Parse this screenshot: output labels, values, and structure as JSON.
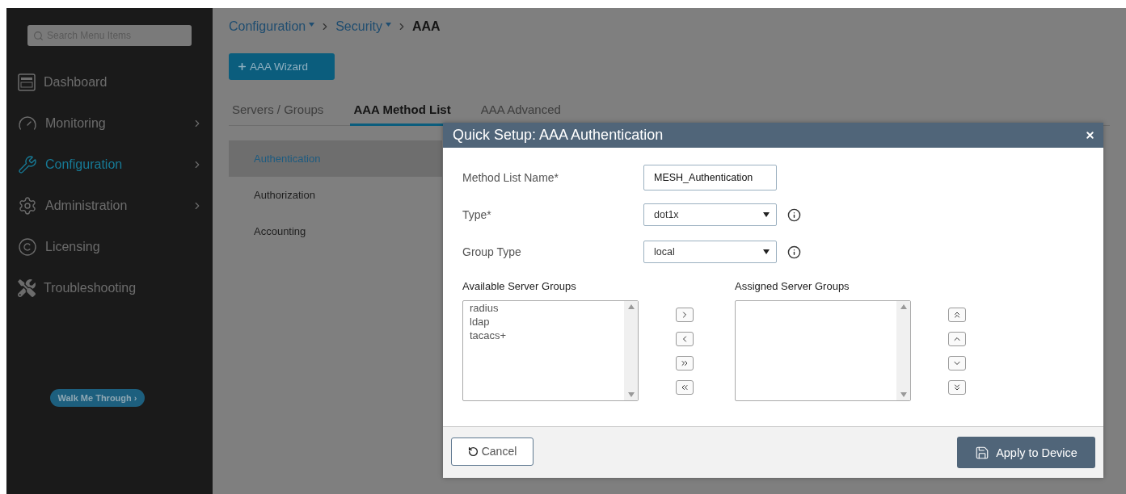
{
  "sidebar": {
    "search": {
      "placeholder": "Search Menu Items"
    },
    "items": [
      {
        "label": "Dashboard",
        "selected": false,
        "has_submenu": false
      },
      {
        "label": "Monitoring",
        "selected": false,
        "has_submenu": true
      },
      {
        "label": "Configuration",
        "selected": true,
        "has_submenu": true
      },
      {
        "label": "Administration",
        "selected": false,
        "has_submenu": true
      },
      {
        "label": "Licensing",
        "selected": false,
        "has_submenu": false
      },
      {
        "label": "Troubleshooting",
        "selected": false,
        "has_submenu": false
      }
    ],
    "walk_button": "Walk Me Through ›"
  },
  "breadcrumb": [
    {
      "label": "Configuration",
      "dropdown": true,
      "current": false
    },
    {
      "label": "Security",
      "dropdown": true,
      "current": false
    },
    {
      "label": "AAA",
      "dropdown": false,
      "current": true
    }
  ],
  "wizard_button": "AAA Wizard",
  "tabs": [
    {
      "label": "Servers / Groups",
      "selected": false
    },
    {
      "label": "AAA Method List",
      "selected": true
    },
    {
      "label": "AAA Advanced",
      "selected": false
    }
  ],
  "submenu": [
    {
      "label": "Authentication",
      "selected": true
    },
    {
      "label": "Authorization",
      "selected": false
    },
    {
      "label": "Accounting",
      "selected": false
    }
  ],
  "dialog": {
    "title": "Quick Setup: AAA Authentication",
    "fields": [
      {
        "label": "Method List Name*",
        "kind": "text",
        "value": "MESH_Authentication"
      },
      {
        "label": "Type*",
        "kind": "select",
        "value": "dot1x",
        "info": true
      },
      {
        "label": "Group Type",
        "kind": "select",
        "value": "local",
        "info": true
      }
    ],
    "available": {
      "label": "Available Server Groups",
      "items": [
        "radius",
        "ldap",
        "tacacs+"
      ]
    },
    "assigned": {
      "label": "Assigned Server Groups"
    },
    "move_buttons": [
      {
        "kind": "right"
      },
      {
        "kind": "left"
      },
      {
        "kind": "all-right"
      },
      {
        "kind": "all-left"
      }
    ],
    "order_buttons": [
      {
        "kind": "top"
      },
      {
        "kind": "up"
      },
      {
        "kind": "down"
      },
      {
        "kind": "bottom"
      }
    ],
    "cancel": "Cancel",
    "apply": "Apply to Device"
  }
}
